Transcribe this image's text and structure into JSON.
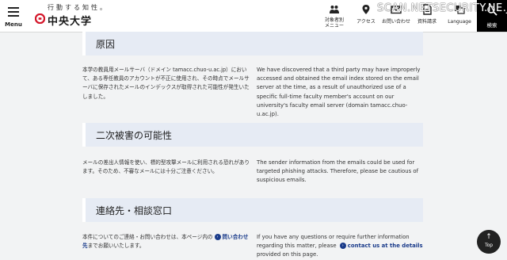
{
  "header": {
    "menu_label": "Menu",
    "tagline": "行動する知性。",
    "university_name": "中央大学",
    "nav": [
      {
        "icon": "people-icon",
        "label": "対象者別\nメニュー"
      },
      {
        "icon": "location-pin-icon",
        "label": "アクセス"
      },
      {
        "icon": "mail-icon",
        "label": "お問い合わせ"
      },
      {
        "icon": "document-icon",
        "label": "資料請求"
      },
      {
        "icon": "language-icon",
        "label": "Language"
      }
    ],
    "search_label": "検索",
    "watermark": "SCAN.NETSECURITY.NE.JP"
  },
  "sections": [
    {
      "title": "原因",
      "jp": "本学の教員用メールサーバ（ドメイン tamacc.chuo-u.ac.jp）において、ある専任教員のアカウントが不正に使用され、その時点でメールサーバに保存されたメールのインデックスが取得された可能性が発生いたしました。",
      "en": "We have discovered that a third party may have improperly accessed and obtained the email index stored on the email server at the time, as a result of unauthorized use of a specific full-time faculty member's account on our university's faculty email server (domain tamacc.chuo-u.ac.jp)."
    },
    {
      "title": "二次被害の可能性",
      "jp": "メールの差出人情報を使い、標的型攻撃メールに利用される恐れがあります。そのため、不審なメールには十分ご注意ください。",
      "en": "The sender information from the emails could be used for targeted phishing attacks. Therefore, please be cautious of suspicious emails."
    },
    {
      "title": "連絡先・相談窓口",
      "jp_before": "本件についてのご連絡・お問い合わせは、本ページ内の",
      "jp_link": "問い合わせ先",
      "jp_after": "までお願いいたします。",
      "en_before": "If you have any questions or require further information regarding this matter, please",
      "en_link": "contact us at the details",
      "en_after": "provided on this page."
    }
  ],
  "top_button_label": "Top",
  "colors": {
    "section_header_bg": "#e6ebf4",
    "link": "#1a3b8a",
    "brand_red": "#d4162a"
  }
}
